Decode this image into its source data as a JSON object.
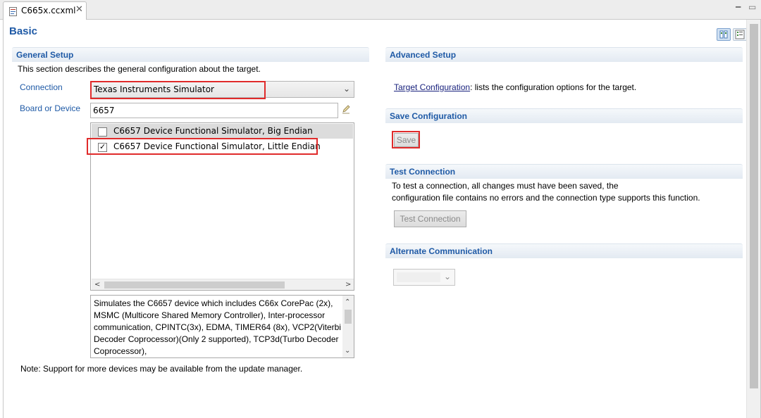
{
  "tab": {
    "label": "C665x.ccxml"
  },
  "page": {
    "title": "Basic"
  },
  "general": {
    "title": "General Setup",
    "description": "This section describes the general configuration about the target.",
    "connection_label": "Connection",
    "connection_value": "Texas Instruments Simulator",
    "board_label": "Board or Device",
    "board_value": "6657",
    "devices": [
      {
        "label": "C6657 Device Functional Simulator, Big Endian",
        "checked": false
      },
      {
        "label": "C6657 Device Functional Simulator, Little Endian",
        "checked": true
      }
    ],
    "device_description": "Simulates the C6657 device which includes C66x CorePac (2x), MSMC (Multicore Shared Memory Controller), Inter-processor communication, CPINTC(3x), EDMA, TIMER64 (8x), VCP2(Viterbi Decoder Coprocessor)(Only 2 supported), TCP3d(Turbo Decoder Coprocessor),",
    "note": "Note: Support for more devices may be available from the update manager."
  },
  "advanced": {
    "title": "Advanced Setup",
    "link": "Target Configuration",
    "link_suffix": ": lists the configuration options for the target."
  },
  "save": {
    "title": "Save Configuration",
    "button": "Save"
  },
  "test": {
    "title": "Test Connection",
    "line1": "To test a connection, all changes must have been saved, the",
    "line2": "configuration file contains no errors and the connection type supports this function.",
    "button": "Test Connection"
  },
  "alternate": {
    "title": "Alternate Communication",
    "value": ""
  },
  "icons": {
    "file": "xml-file-icon",
    "close": "close-icon",
    "minimize": "minimize-icon",
    "maximize": "maximize-icon",
    "layout_columns": "column-layout-icon",
    "layout_list": "list-layout-icon",
    "edit": "pencil-icon"
  },
  "colors": {
    "section_title": "#1f5aa6",
    "highlight": "#e02b2b",
    "link": "#1a237e"
  }
}
